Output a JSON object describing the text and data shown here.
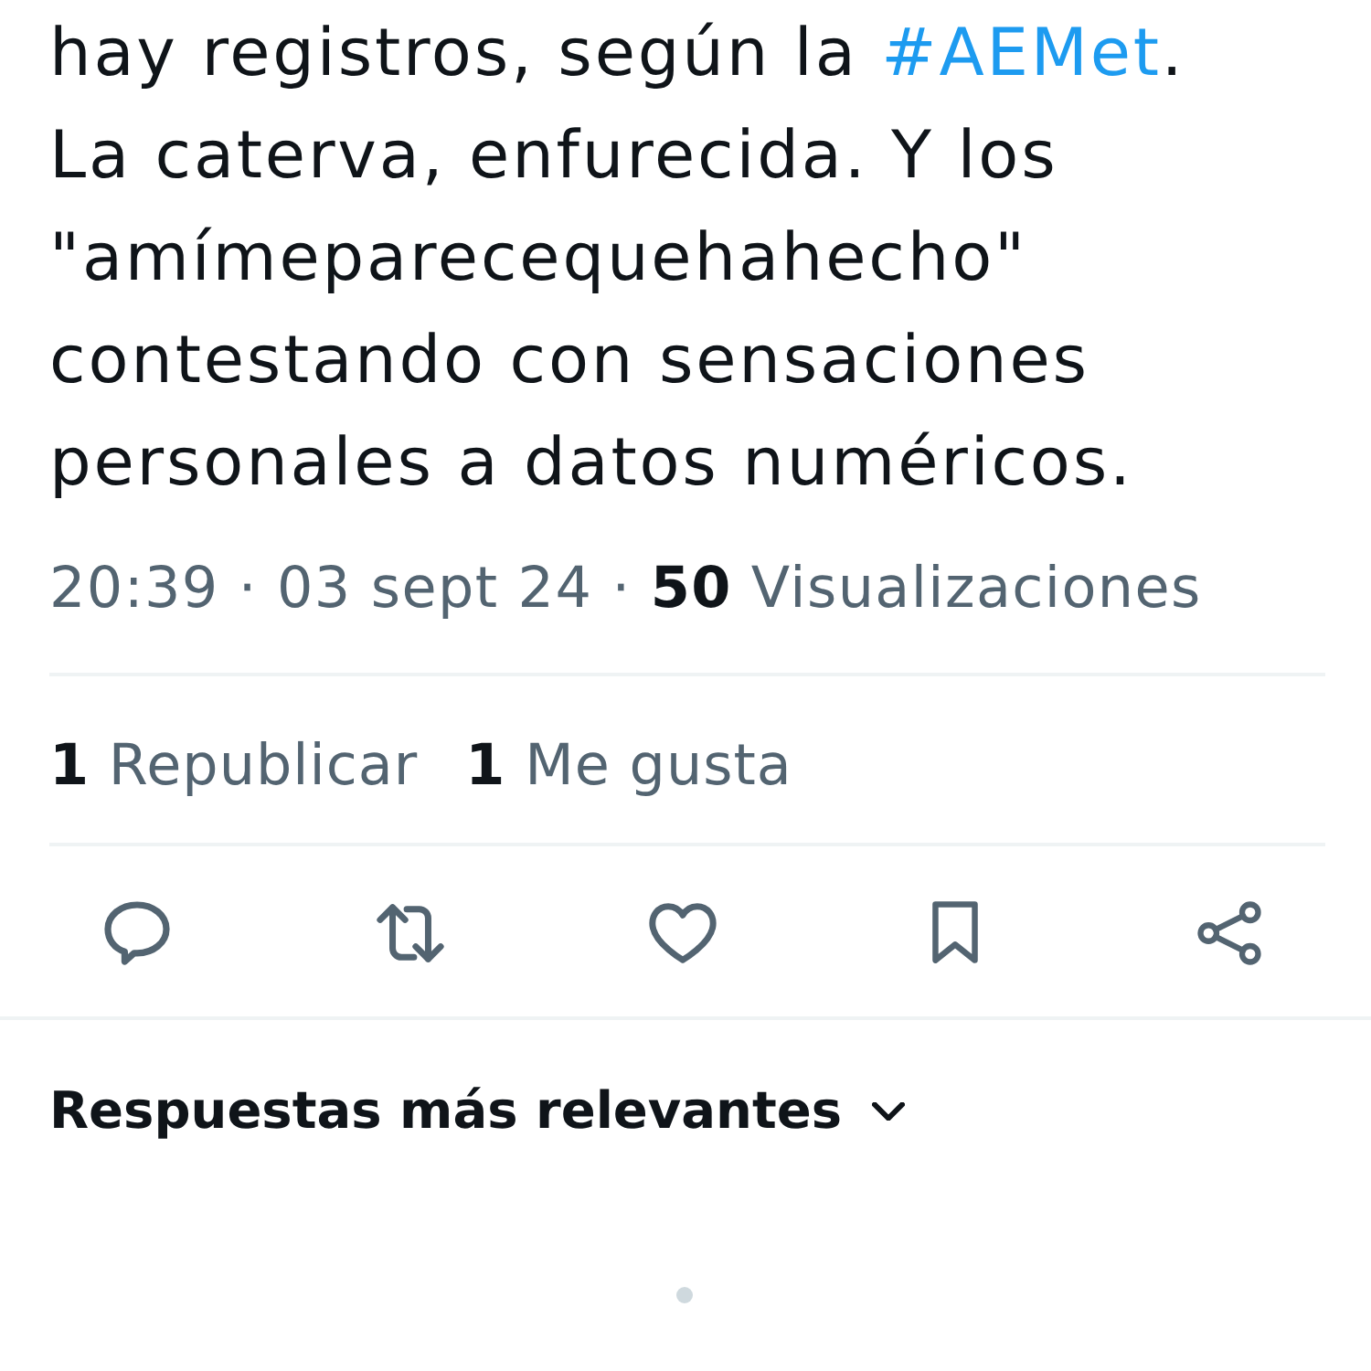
{
  "tweet": {
    "text": [
      {
        "kind": "text",
        "text": "hay registros, según la "
      },
      {
        "kind": "hashtag",
        "text": "#AEMet"
      },
      {
        "kind": "text",
        "text": ".\nLa caterva, enfurecida. Y los\n\"amímeparecequehahecho\"\ncontestando con sensaciones\npersonales a datos numéricos."
      }
    ],
    "meta": "20:39 · 03 sept 24 · **50** Visualizaciones",
    "stats": [
      {
        "count": "1",
        "label": "Republicar"
      },
      {
        "count": "1",
        "label": "Me gusta"
      }
    ],
    "actions": [
      {
        "kind": "reply"
      },
      {
        "kind": "repost"
      },
      {
        "kind": "like"
      },
      {
        "kind": "bookmark"
      },
      {
        "kind": "share"
      }
    ]
  },
  "replies": {
    "sort": {
      "label": "Respuestas más relevantes"
    }
  }
}
